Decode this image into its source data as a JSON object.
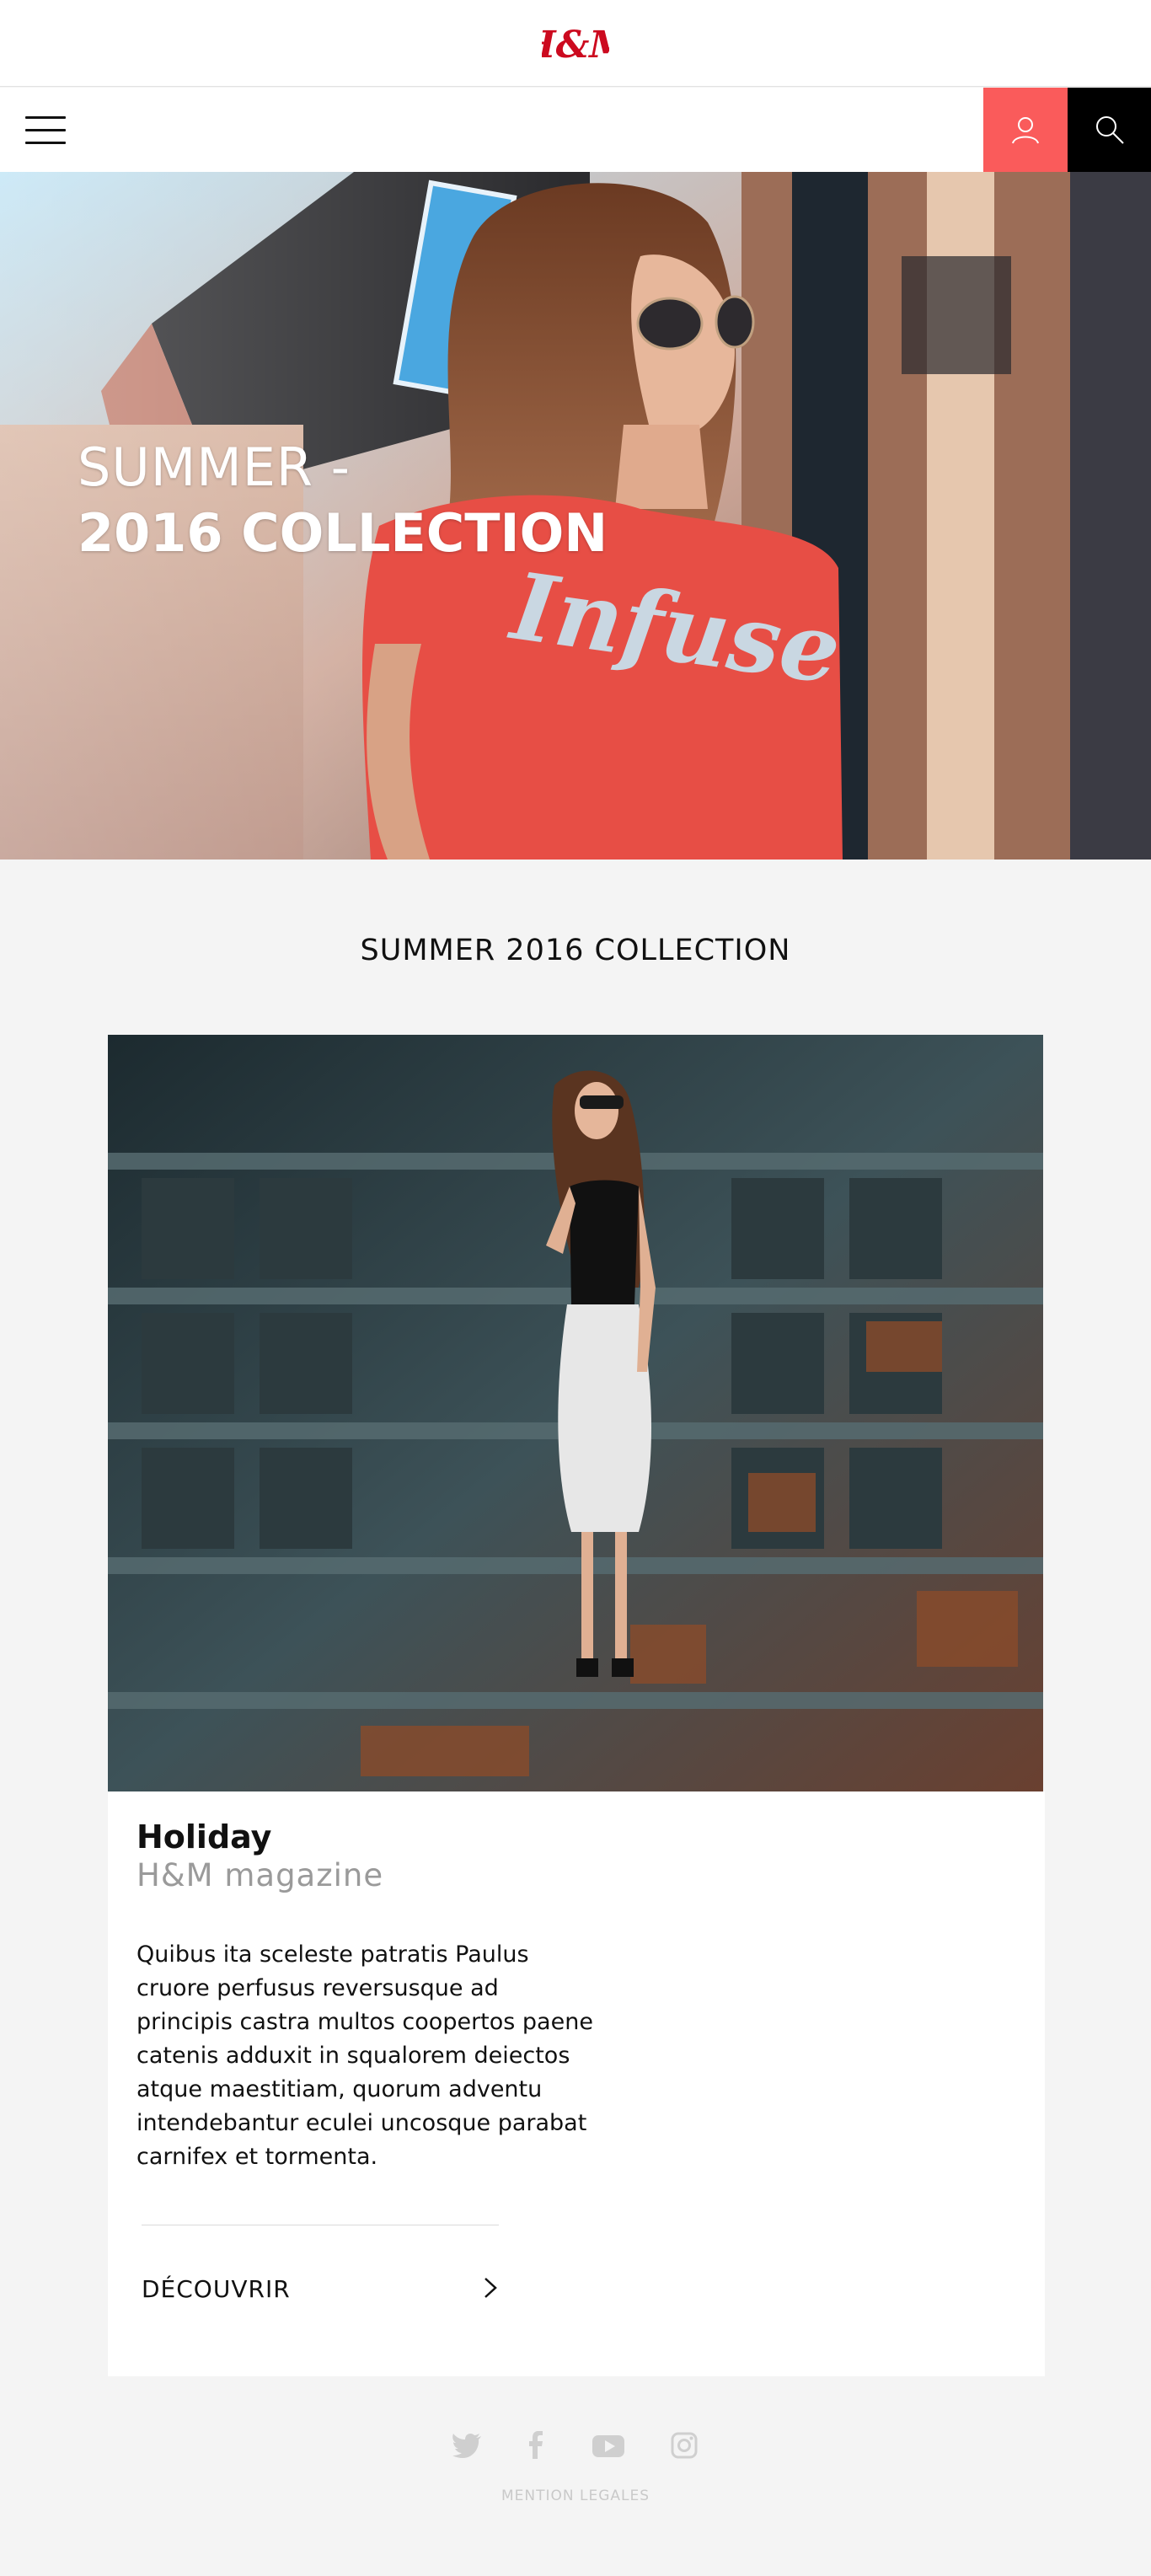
{
  "brand": {
    "logo_text": "H&M",
    "logo_color": "#cc0a1f"
  },
  "nav": {
    "menu_icon": "hamburger-menu-icon",
    "account_icon": "user-icon",
    "search_icon": "search-icon",
    "account_bg": "#fa5b5b",
    "search_bg": "#000000"
  },
  "hero": {
    "title_line1": "SUMMER -",
    "title_line2": "2016 COLLECTION",
    "image_alt": "Woman in red Infuse t-shirt and sunglasses",
    "shirt_text": "Infuse"
  },
  "section": {
    "title": "SUMMER 2016 COLLECTION"
  },
  "card": {
    "image_alt": "Woman in white pencil skirt standing in rusty industrial setting",
    "title": "Holiday",
    "subtitle": "H&M magazine",
    "body_lines": [
      "Quibus ita sceleste patratis Paulus",
      "cruore perfusus reversusque ad",
      "principis castra multos coopertos paene",
      "catenis adduxit in squalorem deiectos",
      "atque maestitiam, quorum adventu",
      "intendebantur eculei uncosque parabat",
      "carnifex et tormenta."
    ],
    "cta_label": "DÉCOUVRIR",
    "cta_icon": "chevron-right-icon"
  },
  "footer": {
    "social_icons": [
      "twitter-icon",
      "facebook-icon",
      "youtube-icon",
      "instagram-icon"
    ],
    "legal": "MENTION LEGALES"
  }
}
